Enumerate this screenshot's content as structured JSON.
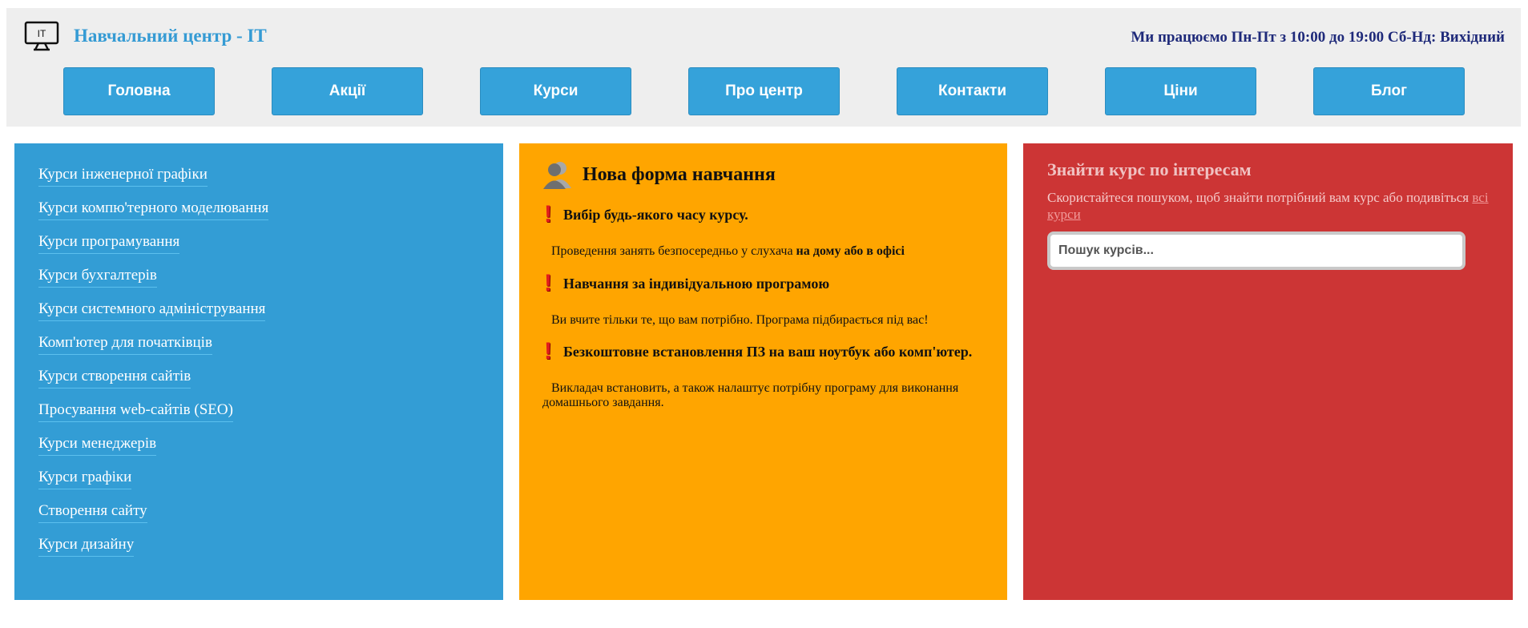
{
  "header": {
    "site_title": "Навчальний центр - IT",
    "logo_text": "IT",
    "hours": "Ми працюємо Пн-Пт з 10:00 до 19:00 Сб-Нд: Вихідний"
  },
  "nav": {
    "items": [
      {
        "label": "Головна"
      },
      {
        "label": "Акції"
      },
      {
        "label": "Курси"
      },
      {
        "label": "Про центр"
      },
      {
        "label": "Контакти"
      },
      {
        "label": "Ціни"
      },
      {
        "label": "Блог"
      }
    ]
  },
  "courses": {
    "items": [
      {
        "label": "Курси інженерної графіки"
      },
      {
        "label": "Курси компю'терного моделювання"
      },
      {
        "label": "Курси програмування"
      },
      {
        "label": "Курси бухгалтерів"
      },
      {
        "label": "Курси системного адміністрування"
      },
      {
        "label": "Комп'ютер для початківців"
      },
      {
        "label": "Курси створення сайтів"
      },
      {
        "label": "Просування web-сайтів (SEO)"
      },
      {
        "label": "Курси менеджерів"
      },
      {
        "label": "Курси графіки"
      },
      {
        "label": "Створення сайту"
      },
      {
        "label": "Курси дизайну"
      }
    ]
  },
  "features": {
    "title": "Нова форма навчання",
    "items": [
      {
        "title": "Вибір будь-якого часу курсу.",
        "text": "Проведення занять безпосередньо у слухача ",
        "text_bold": "на дому або в офісі"
      },
      {
        "title": "Навчання за індивідуальною програмою",
        "text": "Ви вчите тільки те, що вам потрібно. Програма підбирається під вас!",
        "text_bold": ""
      },
      {
        "title": "Безкоштовне встановлення ПЗ на ваш ноутбук або комп'ютер.",
        "text": "Викладач встановить, а також налаштує потрібну програму для виконання домашнього завдання.",
        "text_bold": ""
      }
    ]
  },
  "search": {
    "title": "Знайти курс по інтересам",
    "text": "Скористайтеся пошуком, щоб знайти потрібний вам курс або подивіться ",
    "link": "всі курси",
    "placeholder": "Пошук курсів...",
    "value": ""
  },
  "colors": {
    "header_bg": "#eeeeee",
    "title": "#359bd4",
    "nav_button": "#35a2da",
    "left_panel": "#339dd5",
    "mid_panel": "#ffa500",
    "right_panel": "#cc3535"
  }
}
